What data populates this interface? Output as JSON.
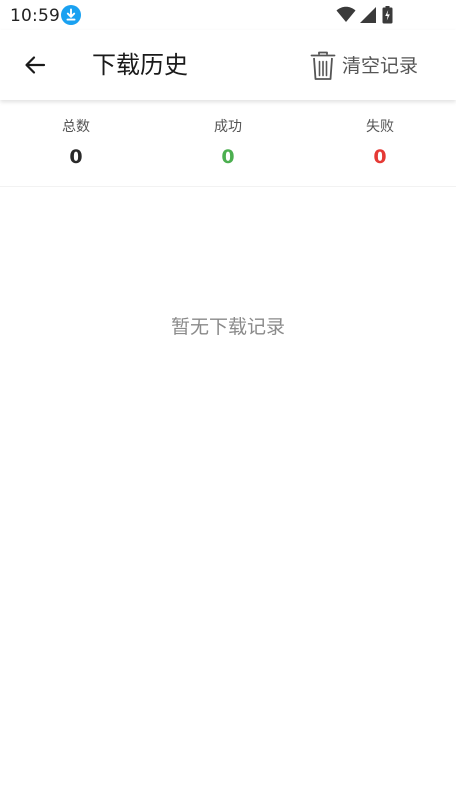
{
  "status_bar": {
    "time": "10:59",
    "download_icon_color": "#1aa1f1"
  },
  "app_bar": {
    "title": "下载历史",
    "clear_label": "清空记录"
  },
  "stats": {
    "total_label": "总数",
    "total_value": "0",
    "success_label": "成功",
    "success_value": "0",
    "fail_label": "失败",
    "fail_value": "0",
    "colors": {
      "success": "#4caf50",
      "fail": "#e53935"
    }
  },
  "empty_state": {
    "message": "暂无下载记录"
  }
}
